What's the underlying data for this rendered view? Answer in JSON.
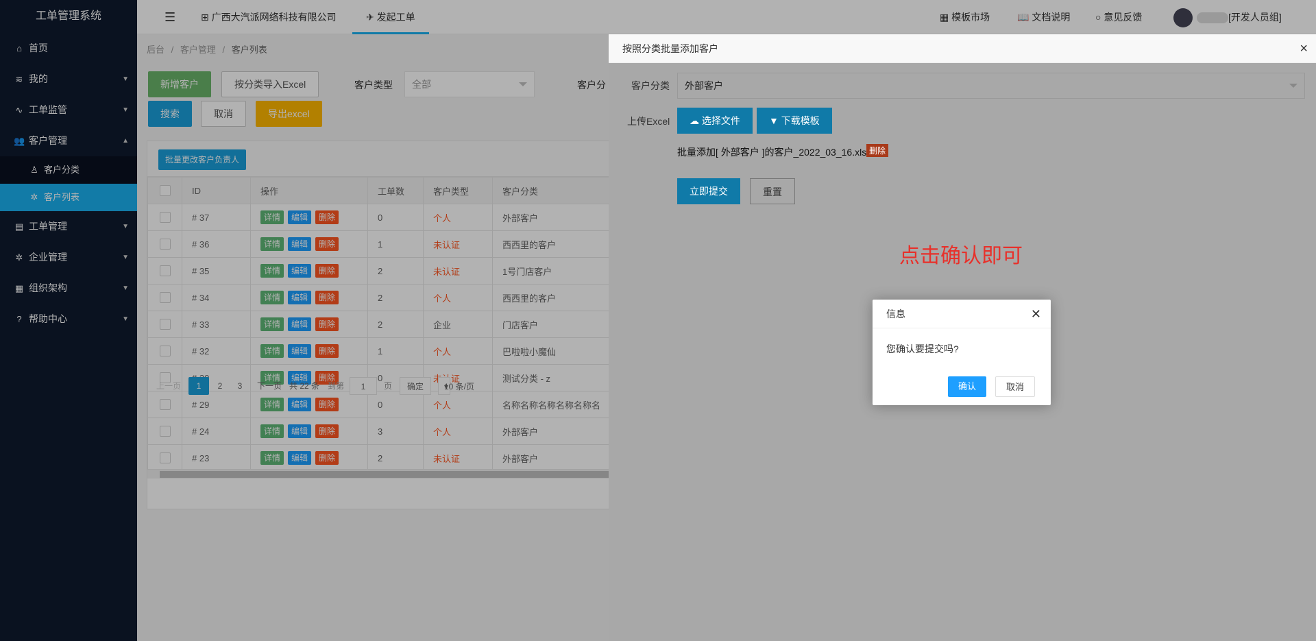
{
  "app": {
    "title": "工单管理系统"
  },
  "sidebar": {
    "items": [
      {
        "label": "首页",
        "icon": "home-icon"
      },
      {
        "label": "我的",
        "icon": "layers-icon"
      },
      {
        "label": "工单监管",
        "icon": "pulse-icon"
      },
      {
        "label": "客户管理",
        "icon": "users-icon"
      },
      {
        "label": "工单管理",
        "icon": "clipboard-icon"
      },
      {
        "label": "企业管理",
        "icon": "gear-icon"
      },
      {
        "label": "组织架构",
        "icon": "calendar-icon"
      },
      {
        "label": "帮助中心",
        "icon": "question-icon"
      }
    ],
    "subitems": [
      {
        "label": "客户分类",
        "icon": "user-icon"
      },
      {
        "label": "客户列表",
        "icon": "gear-icon"
      }
    ]
  },
  "header": {
    "menu_icon": "menu-icon",
    "company": "广西大汽派网络科技有限公司",
    "launch": "发起工单",
    "template_market": "模板市场",
    "docs": "文档说明",
    "feedback": "意见反馈",
    "user_suffix": "[开发人员组]"
  },
  "breadcrumb": {
    "home": "后台",
    "sep": "/",
    "section": "客户管理",
    "current": "客户列表"
  },
  "toolbar": {
    "add": "新增客户",
    "import": "按分类导入Excel",
    "search": "搜索",
    "cancel": "取消",
    "export": "导出excel",
    "type_label": "客户类型",
    "type_value": "全部",
    "category_label": "客户分",
    "batch": "批量更改客户负责人"
  },
  "table": {
    "headers": [
      "ID",
      "操作",
      "工单数",
      "客户类型",
      "客户分类"
    ],
    "actions": {
      "detail": "详情",
      "edit": "编辑",
      "delete": "删除"
    },
    "rows": [
      {
        "id": "# 37",
        "count": "0",
        "type": "个人",
        "category": "外部客户"
      },
      {
        "id": "# 36",
        "count": "1",
        "type": "未认证",
        "category": "西西里的客户"
      },
      {
        "id": "# 35",
        "count": "2",
        "type": "未认证",
        "category": "1号门店客户"
      },
      {
        "id": "# 34",
        "count": "2",
        "type": "个人",
        "category": "西西里的客户"
      },
      {
        "id": "# 33",
        "count": "2",
        "type": "企业",
        "category": "门店客户"
      },
      {
        "id": "# 32",
        "count": "1",
        "type": "个人",
        "category": "巴啦啦小魔仙"
      },
      {
        "id": "# 30",
        "count": "0",
        "type": "未认证",
        "category": "测试分类 - z"
      },
      {
        "id": "# 29",
        "count": "0",
        "type": "个人",
        "category": "名称名称名称名称名称名"
      },
      {
        "id": "# 24",
        "count": "3",
        "type": "个人",
        "category": "外部客户"
      },
      {
        "id": "# 23",
        "count": "2",
        "type": "未认证",
        "category": "外部客户"
      }
    ]
  },
  "pager": {
    "prev": "上一页",
    "pages": [
      "1",
      "2",
      "3"
    ],
    "next": "下一页",
    "total": "共 22 条",
    "goto": "到第",
    "goto_value": "1",
    "page_unit": "页",
    "confirm": "确定",
    "per_page": "10 条/页"
  },
  "drawer": {
    "title": "按照分类批量添加客户",
    "category_label": "客户分类",
    "category_value": "外部客户",
    "upload_label": "上传Excel",
    "choose_file": "选择文件",
    "download_template": "下载模板",
    "file_name": "批量添加[ 外部客户 ]的客户_2022_03_16.xls",
    "file_delete": "删除",
    "submit": "立即提交",
    "reset": "重置",
    "hint": "点击确认即可"
  },
  "dialog": {
    "title": "信息",
    "message": "您确认要提交吗?",
    "confirm": "确认",
    "cancel": "取消"
  },
  "colors": {
    "accent": "#1bb0f0",
    "sidebar": "#0f1a2e",
    "hint": "#e8302a"
  }
}
